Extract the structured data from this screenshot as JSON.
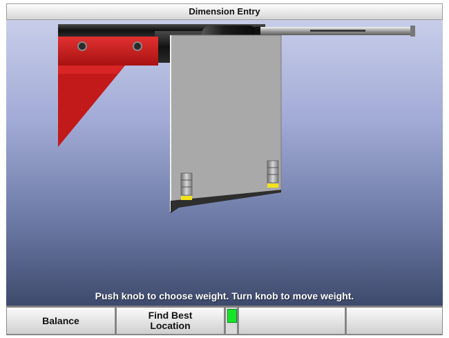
{
  "window": {
    "title": "Dimension Entry"
  },
  "instruction": "Push knob to choose weight.  Turn knob to move weight.",
  "softkeys": [
    {
      "label": "Balance"
    },
    {
      "label": "Find Best\nLocation"
    },
    {
      "label": ""
    },
    {
      "label": ""
    }
  ],
  "status_indicator": {
    "state": "ready",
    "color": "#16e52a"
  },
  "colors": {
    "arm_red": "#c21a1a",
    "rim_gray": "#a9a9a9",
    "weight_marker": "#f2e21a"
  }
}
